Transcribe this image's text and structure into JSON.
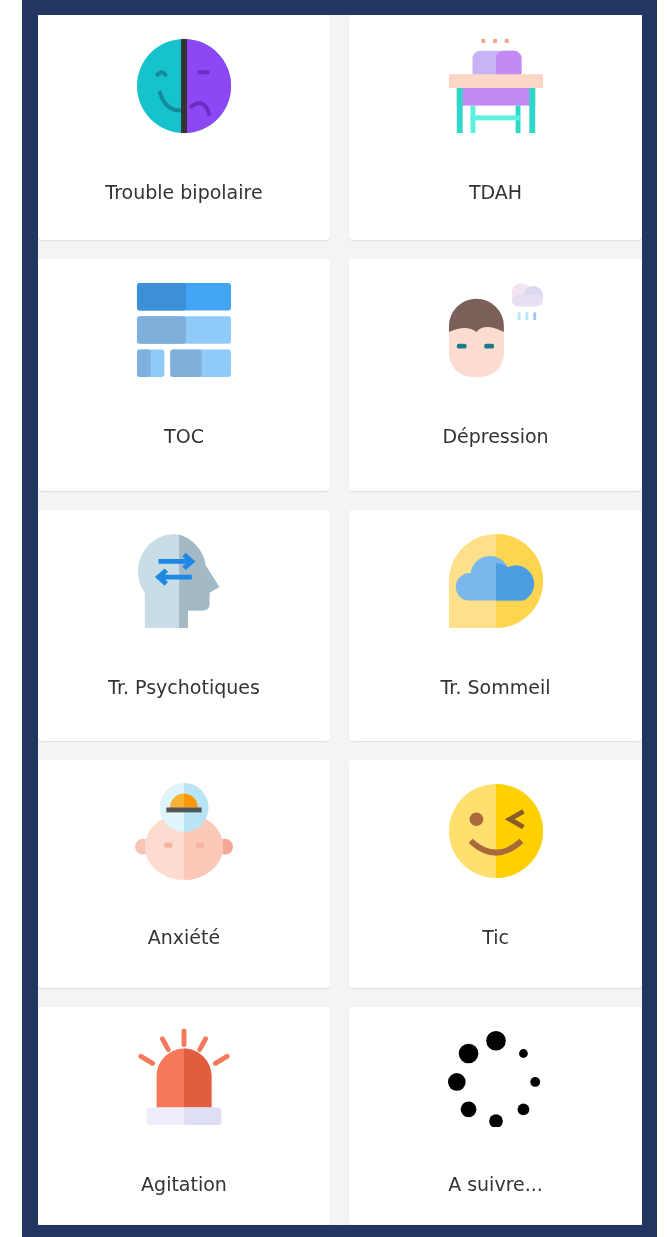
{
  "cards": [
    {
      "kind": "masks",
      "label": "Trouble bipolaire"
    },
    {
      "kind": "desk",
      "label": "TDAH"
    },
    {
      "kind": "blocks",
      "label": "TOC"
    },
    {
      "kind": "sad-face",
      "label": "Dépression"
    },
    {
      "kind": "head",
      "label": "Tr. Psychotiques"
    },
    {
      "kind": "cloud",
      "label": "Tr. Sommeil"
    },
    {
      "kind": "siren-head",
      "label": "Anxiété"
    },
    {
      "kind": "wink",
      "label": "Tic"
    },
    {
      "kind": "siren",
      "label": "Agitation"
    },
    {
      "kind": "spinner",
      "label": "A suivre..."
    }
  ]
}
